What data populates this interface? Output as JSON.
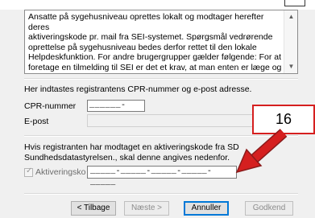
{
  "info": {
    "lines": [
      "Ansatte på sygehusniveau oprettes lokalt og modtager herefter deres",
      "aktiveringskode pr. mail fra SEI-systemet. Spørgsmål vedrørende",
      "oprettelse på sygehusniveau bedes derfor rettet til den lokale",
      "Helpdeskfunktion. For andre brugergrupper gælder følgende: For at",
      "foretage en tilmelding til SEI er det et krav, at man enten er læge og"
    ]
  },
  "form": {
    "instruction": "Her indtastes registrantens CPR-nummer og e-post adresse.",
    "cpr_label": "CPR-nummer",
    "cpr_mask": "______-____",
    "email_label": "E-post",
    "email_value": "",
    "activation_text": [
      "Hvis registranten har modtaget en aktiveringskode fra SD",
      "Sundhedsdatastyrelsen., skal denne angives nedenfor."
    ],
    "activation_checkbox_label": "Aktiveringsko",
    "activation_checked": true,
    "activation_mask": "_____-_____-_____-_____-_____"
  },
  "buttons": {
    "back": "< Tilbage",
    "next": "Næste >",
    "cancel": "Annuller",
    "finish": "Godkend"
  },
  "callout": {
    "number": "16",
    "color": "#d51f1f"
  }
}
